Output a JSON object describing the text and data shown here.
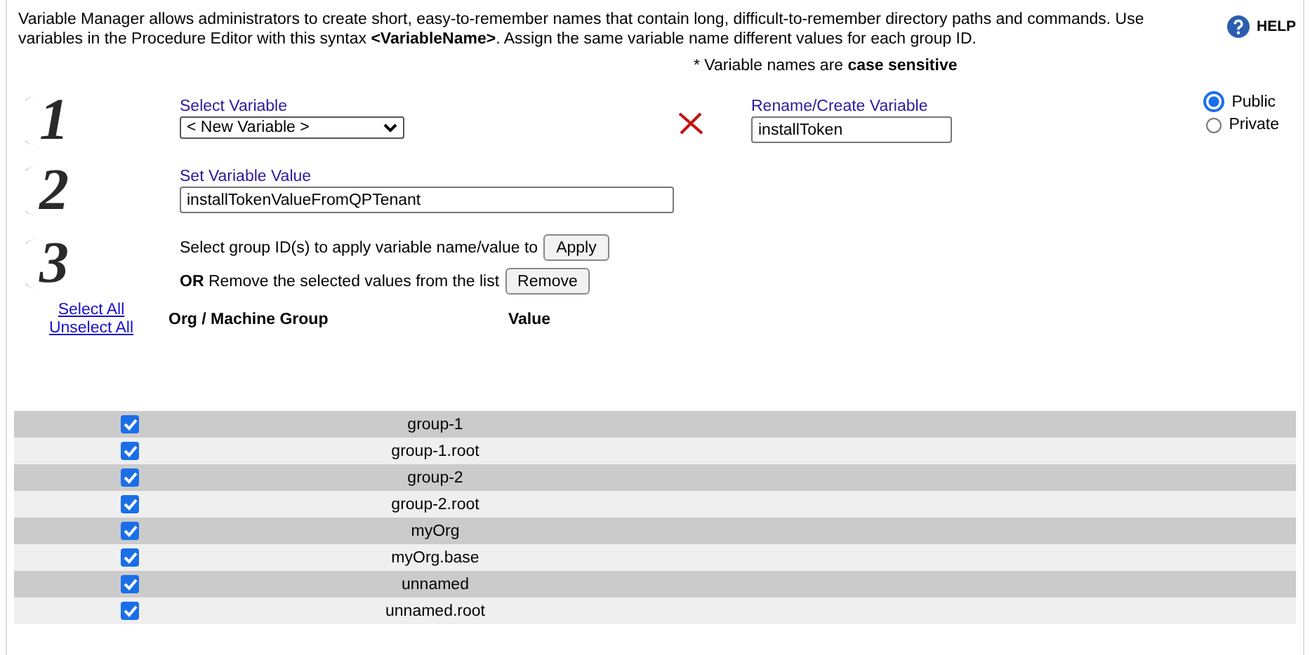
{
  "intro": "Variable Manager allows administrators to create short, easy-to-remember names that contain long, difficult-to-remember directory paths and commands. Use variables in the Procedure Editor with this syntax **<VariableName>**. Assign the same variable name different values for each group ID.",
  "help": {
    "label": "HELP"
  },
  "note": "* Variable names are **case sensitive**",
  "step1": {
    "number": "1",
    "select_label": "Select Variable",
    "select_value": "< New Variable >",
    "rename_label": "Rename/Create Variable",
    "rename_value": "installToken",
    "visibility": [
      {
        "label": "Public",
        "selected": true
      },
      {
        "label": "Private",
        "selected": false
      }
    ]
  },
  "step2": {
    "number": "2",
    "label": "Set Variable Value",
    "value": "installTokenValueFromQPTenant"
  },
  "step3": {
    "number": "3",
    "apply_text": "Select group ID(s) to apply variable name/value to",
    "apply_button": "Apply",
    "remove_text": "**OR** Remove the selected values from the list",
    "remove_button": "Remove"
  },
  "links": [
    "Select All",
    "Unselect All"
  ],
  "table": {
    "columns": [
      "Org / Machine Group",
      "Value"
    ],
    "rows": [
      {
        "name": "group-1",
        "checked": true
      },
      {
        "name": "group-1.root",
        "checked": true
      },
      {
        "name": "group-2",
        "checked": true
      },
      {
        "name": "group-2.root",
        "checked": true
      },
      {
        "name": "myOrg",
        "checked": true
      },
      {
        "name": "myOrg.base",
        "checked": true
      },
      {
        "name": "unnamed",
        "checked": true
      },
      {
        "name": "unnamed.root",
        "checked": true
      }
    ]
  }
}
